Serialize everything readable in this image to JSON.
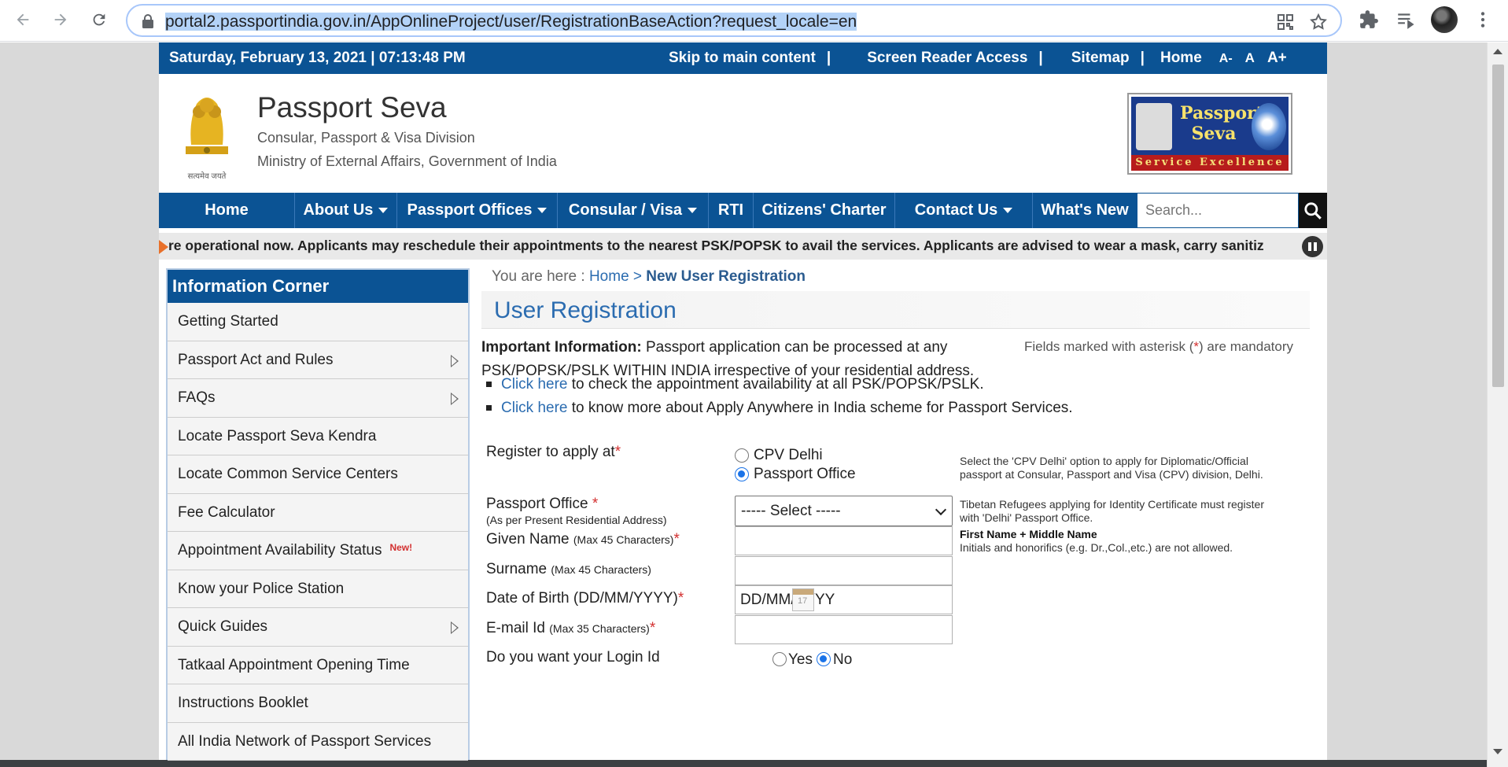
{
  "browser": {
    "url": "portal2.passportindia.gov.in/AppOnlineProject/user/RegistrationBaseAction?request_locale=en"
  },
  "topbar": {
    "datetime": "Saturday,  February  13, 2021 | 07:13:48 PM",
    "skip": "Skip to main content",
    "screen_reader": "Screen Reader Access",
    "sitemap": "Sitemap",
    "home": "Home",
    "font_small": "A-",
    "font_normal": "A",
    "font_large": "A+",
    "sep": "|"
  },
  "header": {
    "title": "Passport Seva",
    "sub1": "Consular, Passport & Visa Division",
    "sub2": "Ministry of External Affairs, Government of India",
    "emblem_motto": "सत्यमेव जयते",
    "logo_title": "Passport Seva",
    "logo_band": "Service Excellence"
  },
  "nav": {
    "items": [
      "Home",
      "About Us",
      "Passport Offices",
      "Consular / Visa",
      "RTI",
      "Citizens' Charter",
      "Contact Us",
      "What's New"
    ],
    "search_placeholder": "Search..."
  },
  "ticker": {
    "text": "re operational now. Applicants may reschedule their appointments to the nearest PSK/POPSK to avail the services. Applicants are advised to wear a mask, carry sanitiz"
  },
  "sidebar": {
    "title": "Information Corner",
    "items": [
      "Getting Started",
      "Passport Act and Rules",
      "FAQs",
      "Locate Passport Seva Kendra",
      "Locate Common Service Centers",
      "Fee Calculator",
      "Appointment Availability Status",
      "Know your Police Station",
      "Quick Guides",
      "Tatkaal Appointment Opening Time",
      "Instructions Booklet",
      "All India Network of Passport Services"
    ],
    "new_badge": "New!"
  },
  "breadcrumb": {
    "prefix": "You are here : ",
    "home": "Home",
    "sep": " > ",
    "current": "New User Registration"
  },
  "page": {
    "heading": "User Registration",
    "info_bold": "Important Information:",
    "info_text": " Passport application can be processed at any PSK/POPSK/PSLK WITHIN INDIA irrespective of your residential address.",
    "mandatory_pre": "Fields marked with asterisk (",
    "mandatory_star": "*",
    "mandatory_post": ") are mandatory",
    "bullet1_link": "Click here",
    "bullet1_text": " to check the appointment availability at all PSK/POPSK/PSLK.",
    "bullet2_link": "Click here",
    "bullet2_text": " to know more about Apply Anywhere in India scheme for Passport Services."
  },
  "form": {
    "register_label": "Register to apply at",
    "opt_cpv": "CPV Delhi",
    "opt_po": "Passport Office",
    "help_cpv_1": "Select the 'CPV Delhi' option to apply for Diplomatic/Official",
    "help_cpv_2": "passport at Consular, Passport and Visa (CPV) division, Delhi.",
    "po_label": "Passport Office ",
    "po_sub": "(As per Present Residential Address)",
    "po_selected": "----- Select -----",
    "help_po_1": "Tibetan Refugees applying for Identity Certificate must register",
    "help_po_2": "with 'Delhi' Passport Office.",
    "given_label": "Given Name ",
    "given_hint": "(Max 45 Characters)",
    "help_given_bold": "First Name + Middle Name",
    "help_given_2": "Initials and honorifics (e.g. Dr.,Col.,etc.) are not allowed.",
    "surname_label": "Surname ",
    "surname_hint": "(Max 45 Characters)",
    "dob_label": "Date of Birth (DD/MM/YYYY)",
    "dob_value": "DD/MM/YYYY",
    "cal_day": "17",
    "email_label": "E-mail Id ",
    "email_hint": "(Max 35 Characters)",
    "login_label": "Do you want your Login Id",
    "opt_yes": "Yes",
    "opt_no": "No",
    "star": "*"
  },
  "colors": {
    "brand_blue": "#0b5394",
    "link_blue": "#2b6cb0",
    "required_red": "#d32f2f"
  }
}
